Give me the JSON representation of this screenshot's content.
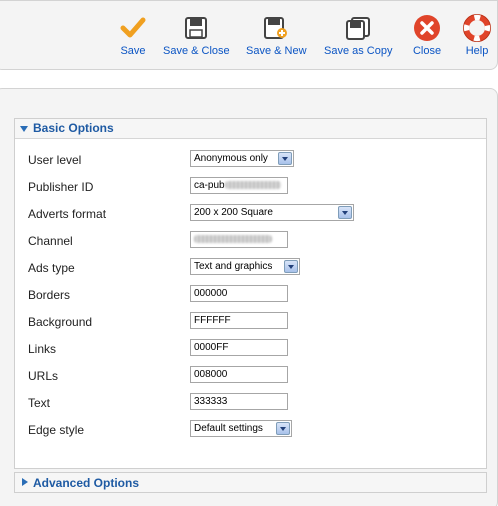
{
  "toolbar": {
    "buttons": [
      {
        "label": "Save",
        "icon": "checkmark-icon"
      },
      {
        "label": "Save & Close",
        "icon": "floppy-disk-icon"
      },
      {
        "label": "Save & New",
        "icon": "floppy-disk-new-icon"
      },
      {
        "label": "Save as Copy",
        "icon": "floppy-disk-copy-icon"
      },
      {
        "label": "Close",
        "icon": "close-icon"
      },
      {
        "label": "Help",
        "icon": "lifebuoy-icon"
      }
    ]
  },
  "basic_options": {
    "title": "Basic Options",
    "fields": [
      {
        "label": "User level",
        "type": "select",
        "value": "Anonymous only"
      },
      {
        "label": "Publisher ID",
        "type": "input",
        "value": "ca-pub"
      },
      {
        "label": "Adverts format",
        "type": "select",
        "value": "200 x 200 Square"
      },
      {
        "label": "Channel",
        "type": "input",
        "value": ""
      },
      {
        "label": "Ads type",
        "type": "select",
        "value": "Text and graphics"
      },
      {
        "label": "Borders",
        "type": "input",
        "value": "000000"
      },
      {
        "label": "Background",
        "type": "input",
        "value": "FFFFFF"
      },
      {
        "label": "Links",
        "type": "input",
        "value": "0000FF"
      },
      {
        "label": "URLs",
        "type": "input",
        "value": "008000"
      },
      {
        "label": "Text",
        "type": "input",
        "value": "333333"
      },
      {
        "label": "Edge style",
        "type": "select",
        "value": "Default settings"
      }
    ]
  },
  "advanced_options": {
    "title": "Advanced Options"
  },
  "colors": {
    "accent": "#1e5aa3",
    "save": "#f0a020",
    "close": "#e0442a"
  }
}
